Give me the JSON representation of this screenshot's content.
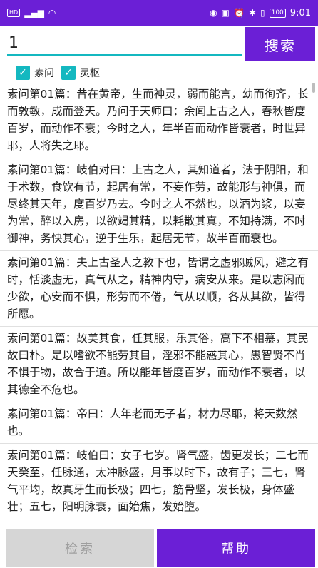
{
  "status_bar": {
    "hd": "HD",
    "signal": "4G",
    "battery": "100",
    "time": "9:01"
  },
  "search": {
    "value": "1",
    "button_label": "搜索"
  },
  "filters": [
    {
      "label": "素问",
      "checked": true
    },
    {
      "label": "灵枢",
      "checked": true
    }
  ],
  "results": [
    "素问第01篇：昔在黄帝，生而神灵，弱而能言，幼而徇齐，长而敦敏，成而登天。乃问于天师曰：余闻上古之人，春秋皆度百岁，而动作不衰；今时之人，年半百而动作皆衰者，时世异耶，人将失之耶。",
    "素问第01篇：岐伯对曰：上古之人，其知道者，法于阴阳，和于术数，食饮有节，起居有常，不妄作劳，故能形与神俱，而尽终其天年，度百岁乃去。今时之人不然也，以酒为浆，以妄为常，醉以入房，以欲竭其精，以耗散其真，不知持满，不时御神，务快其心，逆于生乐，起居无节，故半百而衰也。",
    "素问第01篇：夫上古圣人之教下也，皆谓之虚邪贼风，避之有时，恬淡虚无，真气从之，精神内守，病安从来。是以志闲而少欲，心安而不惧，形劳而不倦，气从以顺，各从其欲，皆得所愿。",
    "素问第01篇：故美其食，任其服，乐其俗，高下不相慕，其民故曰朴。是以嗜欲不能劳其目，淫邪不能惑其心，愚智贤不肖不惧于物，故合于道。所以能年皆度百岁，而动作不衰者，以其德全不危也。",
    "素问第01篇：帝曰：人年老而无子者，材力尽耶，将天数然也。",
    "素问第01篇：岐伯曰：女子七岁。肾气盛，齿更发长；二七而天癸至，任脉通，太冲脉盛，月事以时下，故有子；三七，肾气平均，故真牙生而长极；四七，筋骨坚，发长极，身体盛壮；五七，阳明脉衰，面始焦，发始堕。"
  ],
  "bottom": {
    "retrieve_label": "检索",
    "help_label": "帮助"
  }
}
